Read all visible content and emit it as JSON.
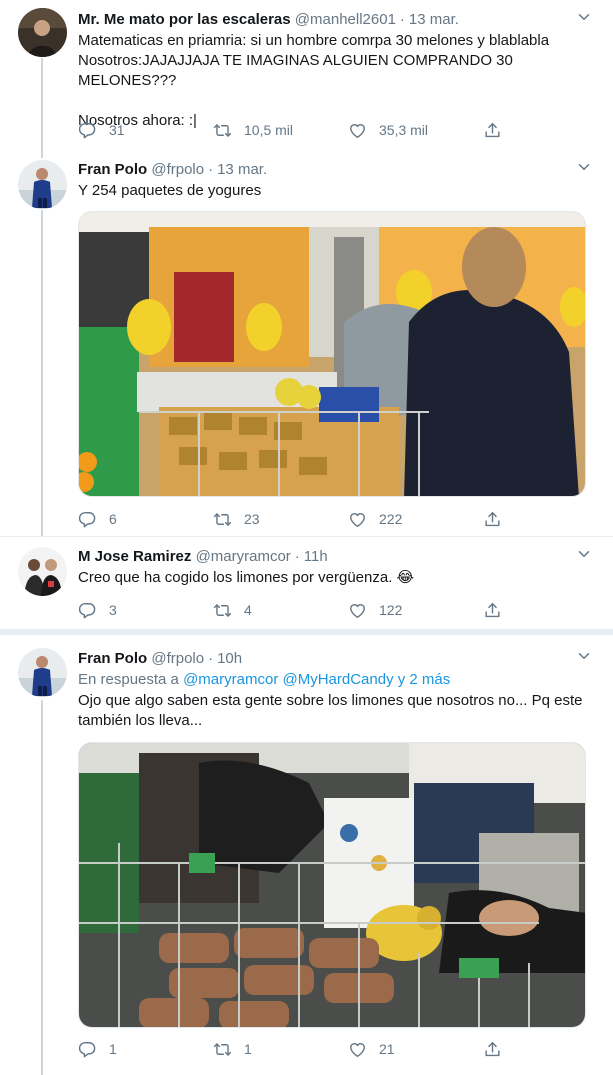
{
  "tweets": [
    {
      "name": "Mr. Me mato por las escaleras",
      "handle": "@manhell2601",
      "time": "13 mar.",
      "text": "Matematicas en priamria: si un hombre comrpa 30 melones y blablabla\nNosotros:JAJAJJAJA TE IMAGINAS ALGUIEN COMPRANDO 30 MELONES???\n\nNosotros ahora:  :|",
      "replies": "31",
      "retweets": "10,5 mil",
      "likes": "35,3 mil"
    },
    {
      "name": "Fran Polo",
      "handle": "@frpolo",
      "time": "13 mar.",
      "text": "Y 254 paquetes de yogures",
      "replies": "6",
      "retweets": "23",
      "likes": "222"
    },
    {
      "name": "M Jose Ramirez",
      "handle": "@maryramcor",
      "time": "11h",
      "text": "Creo que ha cogido los limones por vergüenza. 😂",
      "replies": "3",
      "retweets": "4",
      "likes": "122"
    },
    {
      "name": "Fran Polo",
      "handle": "@frpolo",
      "time": "10h",
      "reply_prefix": "En respuesta a",
      "reply_mentions": "@maryramcor @MyHardCandy y 2 más",
      "text": "Ojo que algo saben esta gente sobre los limones que nosotros no... Pq este también los lleva...",
      "replies": "1",
      "retweets": "1",
      "likes": "21"
    }
  ],
  "icons": {
    "reply": "reply-icon",
    "retweet": "retweet-icon",
    "like": "heart-icon",
    "share": "share-icon",
    "more": "chevron-down-icon"
  },
  "colors": {
    "text": "#14171a",
    "secondary": "#657786",
    "link": "#1b95e0",
    "border": "#e6ecf0"
  }
}
